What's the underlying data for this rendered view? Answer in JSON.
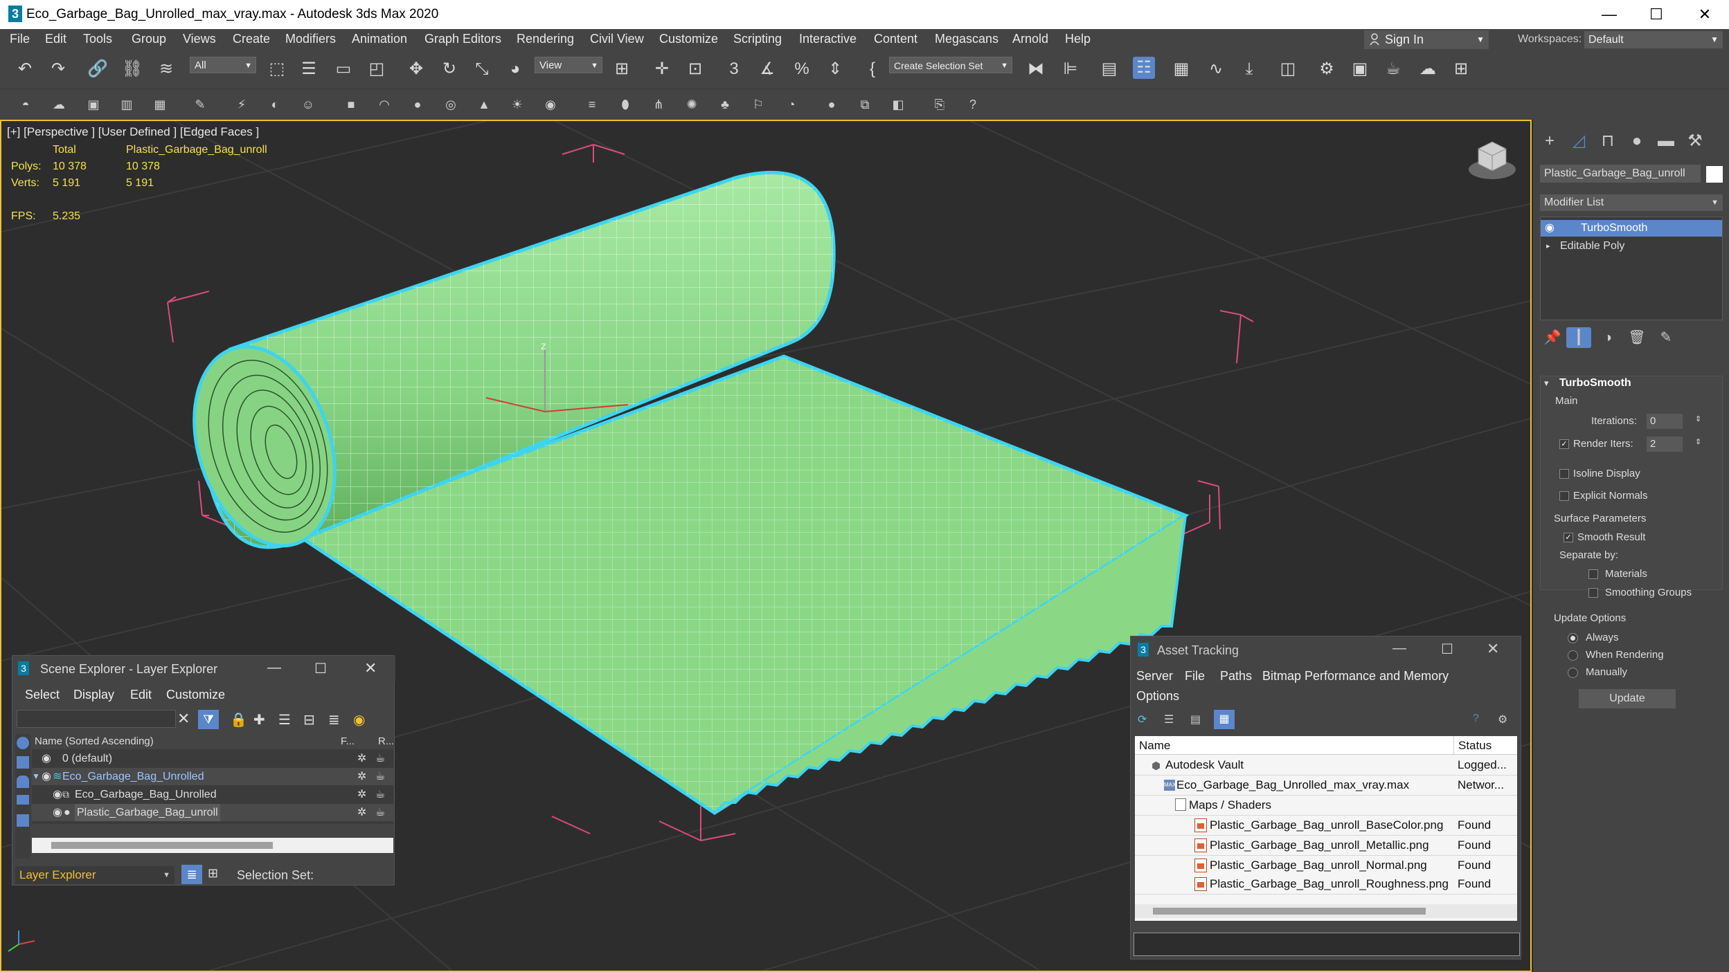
{
  "window": {
    "title": "Eco_Garbage_Bag_Unrolled_max_vray.max - Autodesk 3ds Max 2020",
    "logo": "3",
    "minimize": "—",
    "maximize": "☐",
    "close": "✕"
  },
  "menubar": {
    "items": [
      "File",
      "Edit",
      "Tools",
      "Group",
      "Views",
      "Create",
      "Modifiers",
      "Animation",
      "Graph Editors",
      "Rendering",
      "Civil View",
      "Customize",
      "Scripting",
      "Interactive",
      "Content",
      "Megascans",
      "Arnold",
      "Help"
    ],
    "sign_in": "Sign In",
    "workspaces_label": "Workspaces:",
    "workspace_value": "Default"
  },
  "toolbar": {
    "filter_value": "All",
    "refcoord_value": "View",
    "selection_set_placeholder": "Create Selection Set"
  },
  "viewport": {
    "label": "[+] [Perspective ] [User Defined ] [Edged Faces ]",
    "stats": {
      "total_header": "Total",
      "object_header": "Plastic_Garbage_Bag_unroll",
      "polys_label": "Polys:",
      "polys_total": "10 378",
      "polys_obj": "10 378",
      "verts_label": "Verts:",
      "verts_total": "5 191",
      "verts_obj": "5 191",
      "fps_label": "FPS:",
      "fps_value": "5.235"
    },
    "axis_label": "z"
  },
  "command_panel": {
    "object_name": "Plastic_Garbage_Bag_unroll",
    "modifier_list": "Modifier List",
    "stack": [
      "TurboSmooth",
      "Editable Poly"
    ],
    "rollout_title": "TurboSmooth",
    "main_label": "Main",
    "iterations_label": "Iterations:",
    "iterations_value": "0",
    "render_iters_label": "Render Iters:",
    "render_iters_value": "2",
    "isoline_label": "Isoline Display",
    "explicit_normals_label": "Explicit Normals",
    "surface_params_label": "Surface Parameters",
    "smooth_result_label": "Smooth Result",
    "separate_by_label": "Separate by:",
    "materials_label": "Materials",
    "smoothing_groups_label": "Smoothing Groups",
    "update_options_label": "Update Options",
    "always_label": "Always",
    "when_rendering_label": "When Rendering",
    "manually_label": "Manually",
    "update_button": "Update"
  },
  "scene_explorer": {
    "title": "Scene Explorer - Layer Explorer",
    "menu": [
      "Select",
      "Display",
      "Edit",
      "Customize"
    ],
    "col_name": "Name (Sorted Ascending)",
    "col_f": "F...",
    "col_r": "R...",
    "rows": [
      {
        "label": "0 (default)"
      },
      {
        "label": "Eco_Garbage_Bag_Unrolled"
      },
      {
        "label": "Eco_Garbage_Bag_Unrolled"
      },
      {
        "label": "Plastic_Garbage_Bag_unroll"
      }
    ],
    "footer_mode": "Layer Explorer",
    "selection_set_label": "Selection Set:"
  },
  "asset_tracking": {
    "title": "Asset Tracking",
    "menu": [
      "Server",
      "File",
      "Paths",
      "Bitmap Performance and Memory",
      "Options"
    ],
    "col_name": "Name",
    "col_status": "Status",
    "rows": [
      {
        "name": "Autodesk Vault",
        "status": "Logged..."
      },
      {
        "name": "Eco_Garbage_Bag_Unrolled_max_vray.max",
        "status": "Networ..."
      },
      {
        "name": "Maps / Shaders",
        "status": ""
      },
      {
        "name": "Plastic_Garbage_Bag_unroll_BaseColor.png",
        "status": "Found"
      },
      {
        "name": "Plastic_Garbage_Bag_unroll_Metallic.png",
        "status": "Found"
      },
      {
        "name": "Plastic_Garbage_Bag_unroll_Normal.png",
        "status": "Found"
      },
      {
        "name": "Plastic_Garbage_Bag_unroll_Roughness.png",
        "status": "Found"
      }
    ]
  },
  "colors": {
    "mesh": "#8fdc8c",
    "selection_outline": "#3fd4ee",
    "stats_text": "#f5e14a",
    "highlight": "#5b86c9",
    "bbox": "#d94c7a"
  }
}
